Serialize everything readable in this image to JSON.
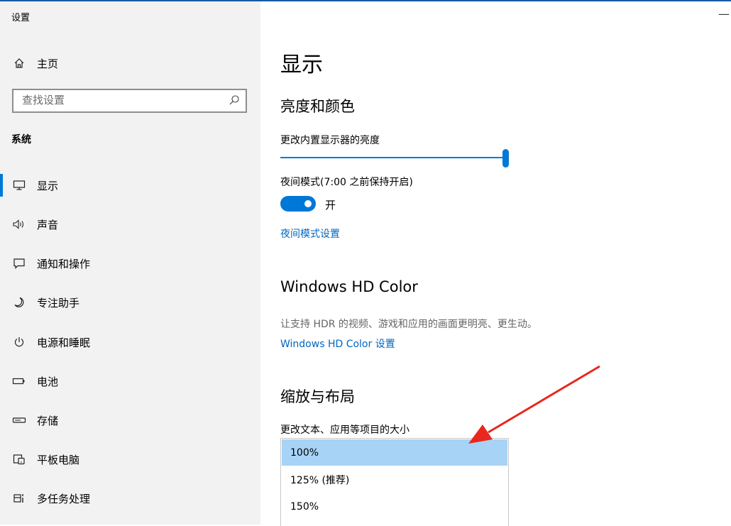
{
  "window": {
    "title": "设置",
    "minimize_glyph": "—"
  },
  "sidebar": {
    "home_label": "主页",
    "search_placeholder": "查找设置",
    "section": "系统",
    "items": [
      {
        "label": "显示",
        "icon": "monitor-icon",
        "active": true
      },
      {
        "label": "声音",
        "icon": "speaker-icon"
      },
      {
        "label": "通知和操作",
        "icon": "notification-icon"
      },
      {
        "label": "专注助手",
        "icon": "moon-icon"
      },
      {
        "label": "电源和睡眠",
        "icon": "power-icon"
      },
      {
        "label": "电池",
        "icon": "battery-icon"
      },
      {
        "label": "存储",
        "icon": "storage-icon"
      },
      {
        "label": "平板电脑",
        "icon": "tablet-icon"
      },
      {
        "label": "多任务处理",
        "icon": "multitask-icon"
      }
    ]
  },
  "main": {
    "title": "显示",
    "brightness": {
      "heading": "亮度和颜色",
      "label": "更改内置显示器的亮度",
      "level_percent": 100
    },
    "night_light": {
      "label": "夜间模式(7:00 之前保持开启)",
      "state_label": "开",
      "on": true,
      "settings_link": "夜间模式设置"
    },
    "hd_color": {
      "heading": "Windows HD Color",
      "description": "让支持 HDR 的视频、游戏和应用的画面更明亮、更生动。",
      "link": "Windows HD Color 设置"
    },
    "scale_layout": {
      "heading": "缩放与布局",
      "label": "更改文本、应用等项目的大小",
      "options": [
        "100%",
        "125% (推荐)",
        "150%"
      ],
      "selected": "100%"
    }
  },
  "colors": {
    "accent": "#0078d7",
    "link": "#0067c0",
    "selected_option": "#a7d3f6",
    "annotation_arrow": "#e8281e"
  }
}
